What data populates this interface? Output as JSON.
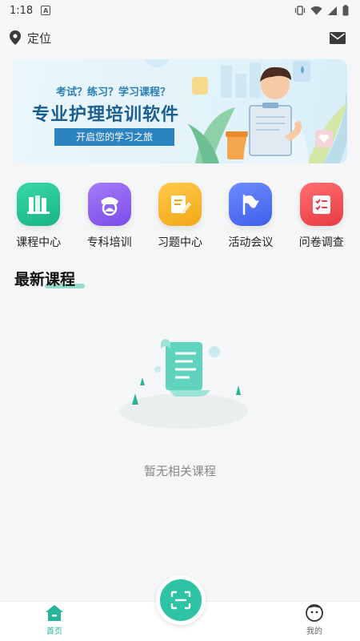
{
  "status_bar": {
    "time": "1:18",
    "icons": [
      "vibrate-icon",
      "wifi-icon",
      "signal-icon",
      "battery-icon"
    ]
  },
  "top_bar": {
    "location_label": "定位",
    "location_icon": "location-pin-icon",
    "message_icon": "mail-icon"
  },
  "banner": {
    "question_text": "考试？练习？学习课程？",
    "title": "专业护理培训软件",
    "ribbon_text": "开启您的学习之旅"
  },
  "categories": [
    {
      "label": "课程中心",
      "icon": "books-icon",
      "color": "#23c08f"
    },
    {
      "label": "专科培训",
      "icon": "nurse-cap-icon",
      "color": "#8a5cf0"
    },
    {
      "label": "习题中心",
      "icon": "exercise-edit-icon",
      "color": "#f3b22b"
    },
    {
      "label": "活动会议",
      "icon": "flag-icon",
      "color": "#4f6ef2"
    },
    {
      "label": "问卷调查",
      "icon": "survey-list-icon",
      "color": "#ef4f57"
    }
  ],
  "section": {
    "title": "最新课程"
  },
  "empty_state": {
    "text": "暂无相关课程"
  },
  "tabbar": {
    "home_label": "首页",
    "mine_label": "我的",
    "scan_icon": "scan-icon"
  },
  "colors": {
    "accent": "#2fc3a5",
    "background": "#f5f6f7"
  }
}
